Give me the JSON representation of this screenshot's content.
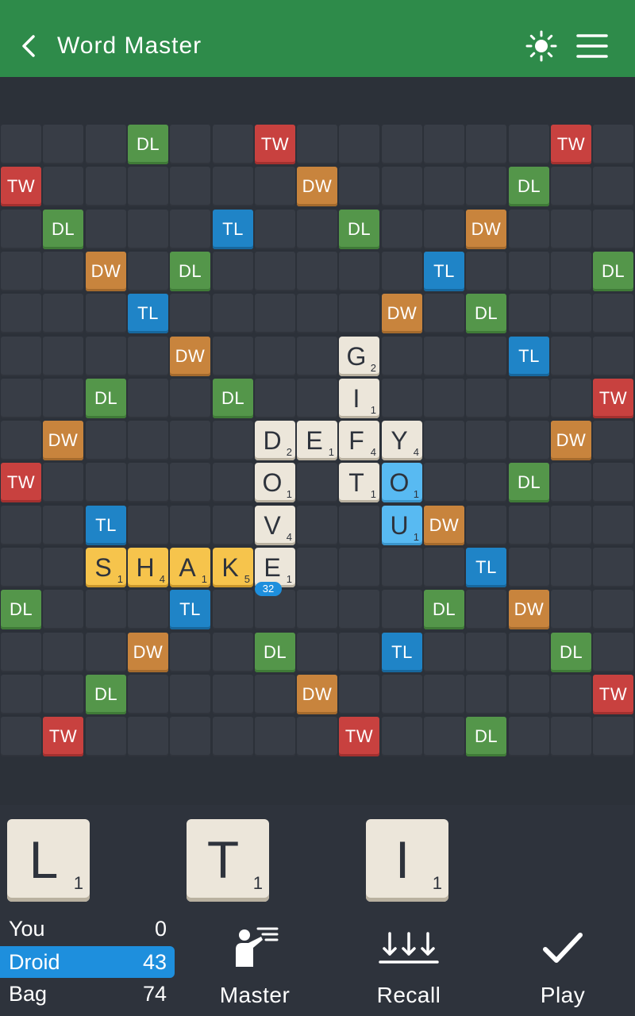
{
  "header": {
    "title": "Word Master",
    "back_icon": "chevron-left-icon",
    "theme_icon": "sun-icon",
    "menu_icon": "hamburger-menu-icon",
    "background": "#2e8b4a"
  },
  "board": {
    "size": 15,
    "premium_squares": [
      {
        "row": 0,
        "col": 3,
        "type": "DL"
      },
      {
        "row": 0,
        "col": 6,
        "type": "TW"
      },
      {
        "row": 0,
        "col": 13,
        "type": "TW"
      },
      {
        "row": 1,
        "col": 0,
        "type": "TW"
      },
      {
        "row": 1,
        "col": 7,
        "type": "DW"
      },
      {
        "row": 1,
        "col": 12,
        "type": "DL"
      },
      {
        "row": 2,
        "col": 1,
        "type": "DL"
      },
      {
        "row": 2,
        "col": 5,
        "type": "TL"
      },
      {
        "row": 2,
        "col": 8,
        "type": "DL"
      },
      {
        "row": 2,
        "col": 11,
        "type": "DW"
      },
      {
        "row": 3,
        "col": 2,
        "type": "DW"
      },
      {
        "row": 3,
        "col": 4,
        "type": "DL"
      },
      {
        "row": 3,
        "col": 10,
        "type": "TL"
      },
      {
        "row": 3,
        "col": 14,
        "type": "DL"
      },
      {
        "row": 4,
        "col": 3,
        "type": "TL"
      },
      {
        "row": 4,
        "col": 9,
        "type": "DW"
      },
      {
        "row": 4,
        "col": 11,
        "type": "DL"
      },
      {
        "row": 5,
        "col": 4,
        "type": "DW"
      },
      {
        "row": 5,
        "col": 12,
        "type": "TL"
      },
      {
        "row": 6,
        "col": 2,
        "type": "DL"
      },
      {
        "row": 6,
        "col": 5,
        "type": "DL"
      },
      {
        "row": 6,
        "col": 14,
        "type": "TW"
      },
      {
        "row": 7,
        "col": 1,
        "type": "DW"
      },
      {
        "row": 7,
        "col": 13,
        "type": "DW"
      },
      {
        "row": 8,
        "col": 0,
        "type": "TW"
      },
      {
        "row": 8,
        "col": 12,
        "type": "DL"
      },
      {
        "row": 9,
        "col": 2,
        "type": "TL"
      },
      {
        "row": 9,
        "col": 10,
        "type": "DW"
      },
      {
        "row": 10,
        "col": 11,
        "type": "TL"
      },
      {
        "row": 11,
        "col": 0,
        "type": "DL"
      },
      {
        "row": 11,
        "col": 4,
        "type": "TL"
      },
      {
        "row": 11,
        "col": 10,
        "type": "DL"
      },
      {
        "row": 11,
        "col": 12,
        "type": "DW"
      },
      {
        "row": 12,
        "col": 3,
        "type": "DW"
      },
      {
        "row": 12,
        "col": 6,
        "type": "DL"
      },
      {
        "row": 12,
        "col": 9,
        "type": "TL"
      },
      {
        "row": 12,
        "col": 13,
        "type": "DL"
      },
      {
        "row": 13,
        "col": 2,
        "type": "DL"
      },
      {
        "row": 13,
        "col": 7,
        "type": "DW"
      },
      {
        "row": 13,
        "col": 14,
        "type": "TW"
      },
      {
        "row": 14,
        "col": 1,
        "type": "TW"
      },
      {
        "row": 14,
        "col": 8,
        "type": "TW"
      },
      {
        "row": 14,
        "col": 11,
        "type": "DL"
      }
    ],
    "tiles": [
      {
        "row": 5,
        "col": 8,
        "letter": "G",
        "points": "2",
        "style": "placed"
      },
      {
        "row": 6,
        "col": 8,
        "letter": "I",
        "points": "1",
        "style": "placed"
      },
      {
        "row": 7,
        "col": 6,
        "letter": "D",
        "points": "2",
        "style": "placed"
      },
      {
        "row": 7,
        "col": 7,
        "letter": "E",
        "points": "1",
        "style": "placed"
      },
      {
        "row": 7,
        "col": 8,
        "letter": "F",
        "points": "4",
        "style": "placed"
      },
      {
        "row": 7,
        "col": 9,
        "letter": "Y",
        "points": "4",
        "style": "placed"
      },
      {
        "row": 8,
        "col": 6,
        "letter": "O",
        "points": "1",
        "style": "placed"
      },
      {
        "row": 8,
        "col": 8,
        "letter": "T",
        "points": "1",
        "style": "placed"
      },
      {
        "row": 8,
        "col": 9,
        "letter": "O",
        "points": "1",
        "style": "last-move"
      },
      {
        "row": 9,
        "col": 6,
        "letter": "V",
        "points": "4",
        "style": "placed"
      },
      {
        "row": 9,
        "col": 9,
        "letter": "U",
        "points": "1",
        "style": "last-move"
      },
      {
        "row": 10,
        "col": 2,
        "letter": "S",
        "points": "1",
        "style": "pending"
      },
      {
        "row": 10,
        "col": 3,
        "letter": "H",
        "points": "4",
        "style": "pending"
      },
      {
        "row": 10,
        "col": 4,
        "letter": "A",
        "points": "1",
        "style": "pending"
      },
      {
        "row": 10,
        "col": 5,
        "letter": "K",
        "points": "5",
        "style": "pending"
      },
      {
        "row": 10,
        "col": 6,
        "letter": "E",
        "points": "1",
        "style": "placed"
      }
    ],
    "move_score": {
      "row": 10,
      "col": 6,
      "value": "32"
    }
  },
  "rack": [
    {
      "letter": "L",
      "points": "1"
    },
    {
      "letter": "T",
      "points": "1"
    },
    {
      "letter": "I",
      "points": "1"
    }
  ],
  "scores": [
    {
      "name": "You",
      "value": "0",
      "active": false
    },
    {
      "name": "Droid",
      "value": "43",
      "active": true
    },
    {
      "name": "Bag",
      "value": "74",
      "active": false
    }
  ],
  "actions": {
    "master": {
      "label": "Master",
      "icon": "teacher-pointing-icon"
    },
    "recall": {
      "label": "Recall",
      "icon": "recall-arrows-icon"
    },
    "play": {
      "label": "Play",
      "icon": "checkmark-icon"
    }
  },
  "colors": {
    "TW": "#c8413f",
    "DW": "#c8843d",
    "DL": "#54964a",
    "TL": "#1f84c7",
    "tile": "#ece6da",
    "pending": "#f6c44c",
    "last_move": "#58baf2",
    "active_score": "#1e8fdd"
  }
}
